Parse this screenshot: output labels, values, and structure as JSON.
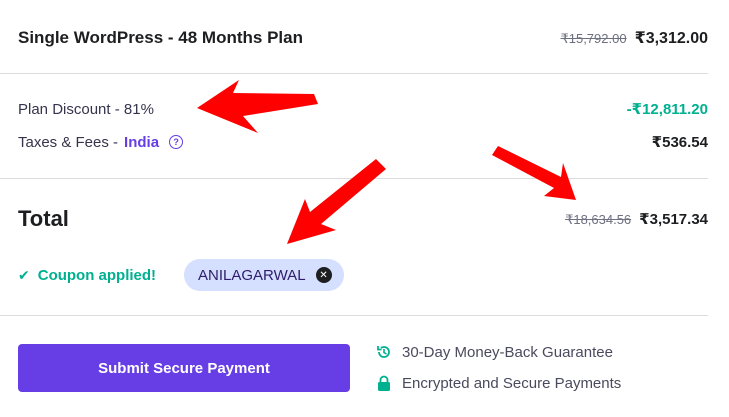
{
  "plan": {
    "title": "Single WordPress - 48 Months Plan",
    "original_price": "₹15,792.00",
    "price": "₹3,312.00"
  },
  "discount": {
    "label": "Plan Discount - 81%",
    "value": "-₹12,811.20"
  },
  "taxes": {
    "label": "Taxes & Fees -",
    "country": "India",
    "help_icon": "question-circle-icon",
    "value": "₹536.54"
  },
  "total": {
    "label": "Total",
    "original_price": "₹18,634.56",
    "price": "₹3,517.34"
  },
  "coupon": {
    "status_icon": "check-icon",
    "status_text": "Coupon applied!",
    "code": "ANILAGARWAL",
    "remove_icon": "close-circle-icon"
  },
  "payment": {
    "submit_label": "Submit Secure Payment"
  },
  "guarantees": [
    {
      "icon": "clock-refresh-icon",
      "text": "30-Day Money-Back Guarantee"
    },
    {
      "icon": "lock-icon",
      "text": "Encrypted and Secure Payments"
    }
  ],
  "colors": {
    "accent": "#673de6",
    "success": "#00b090",
    "chip_bg": "#d5dfff",
    "annotation_arrow": "#ff0000"
  }
}
